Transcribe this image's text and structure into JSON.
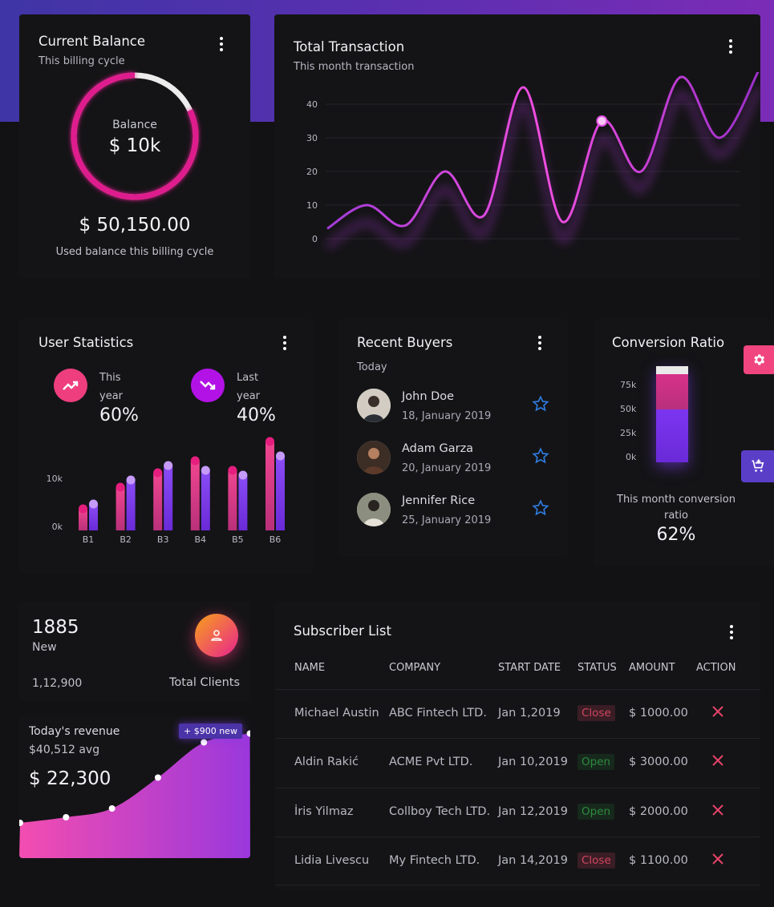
{
  "colors": {
    "accent_pink": "#e91e8c",
    "accent_purple": "#7c3aed",
    "danger": "#d0465f",
    "success": "#2f8a3f",
    "star": "#2f7de1"
  },
  "balance": {
    "title": "Current Balance",
    "subtitle": "This billing cycle",
    "ring_label": "Balance",
    "ring_value": "$ 10k",
    "amount": "$ 50,150.00",
    "caption": "Used balance this billing cycle",
    "ring_progress": 0.82
  },
  "transaction": {
    "title": "Total Transaction",
    "subtitle": "This month transaction"
  },
  "chart_data": {
    "type": "line",
    "title": "Total Transaction",
    "y_ticks": [
      "0",
      "10",
      "20",
      "30",
      "40"
    ],
    "ylim": [
      0,
      45
    ],
    "x": [
      1,
      2,
      3,
      4,
      5,
      6,
      7,
      8,
      9,
      10,
      11
    ],
    "values": [
      3,
      10,
      4,
      20,
      7,
      45,
      5,
      35,
      20,
      48,
      30,
      50
    ],
    "highlight_index": 7,
    "grid": true
  },
  "user_stats": {
    "title": "User Statistics",
    "this_year": {
      "label1": "This",
      "label2": "year",
      "value": "60%",
      "icon": "trending-up-icon"
    },
    "last_year": {
      "label1": "Last",
      "label2": "year",
      "value": "40%",
      "icon": "trending-down-icon"
    },
    "chart": {
      "type": "bar",
      "y_ticks": [
        "10k",
        "0k"
      ],
      "categories": [
        "B1",
        "B2",
        "B3",
        "B4",
        "B5",
        "B6"
      ],
      "series": [
        {
          "values": [
            4.5,
            9,
            12,
            14.5,
            12.5,
            18.5
          ]
        },
        {
          "values": [
            5.5,
            10.5,
            13.5,
            12.5,
            11.5,
            15.5
          ]
        }
      ],
      "max": 20
    }
  },
  "buyers": {
    "title": "Recent Buyers",
    "subtitle": "Today",
    "items": [
      {
        "name": "John Doe",
        "date": "18, January 2019"
      },
      {
        "name": "Adam Garza",
        "date": "20, January 2019"
      },
      {
        "name": "Jennifer Rice",
        "date": "25, January 2019"
      }
    ]
  },
  "conversion": {
    "title": "Conversion Ratio",
    "y_ticks": [
      "75k",
      "50k",
      "25k",
      "0k"
    ],
    "caption_line1": "This month conversion",
    "caption_line2": "ratio",
    "value": "62%",
    "segments": {
      "purple": 0.55,
      "pink": 0.37,
      "light": 0.08
    }
  },
  "clients": {
    "count": "1885",
    "count_label": "New",
    "total": "1,12,900",
    "total_label": "Total Clients",
    "icon": "user-icon"
  },
  "revenue": {
    "title": "Today's revenue",
    "avg": "$40,512 avg",
    "value": "$ 22,300",
    "badge": "+ $900 new",
    "points": [
      0.7,
      0.1,
      0.2,
      0.55,
      0.95,
      1.05
    ]
  },
  "subscribers": {
    "title": "Subscriber List",
    "headers": [
      "NAME",
      "COMPANY",
      "START DATE",
      "STATUS",
      "AMOUNT",
      "ACTION"
    ],
    "rows": [
      {
        "name": "Michael Austin",
        "company": "ABC Fintech LTD.",
        "date": "Jan 1,2019",
        "status": "Close",
        "amount": "$ 1000.00"
      },
      {
        "name": "Aldin Rakić",
        "company": "ACME Pvt LTD.",
        "date": "Jan 10,2019",
        "status": "Open",
        "amount": "$ 3000.00"
      },
      {
        "name": "İris Yilmaz",
        "company": "Collboy Tech LTD.",
        "date": "Jan 12,2019",
        "status": "Open",
        "amount": "$ 2000.00"
      },
      {
        "name": "Lidia Livescu",
        "company": "My Fintech LTD.",
        "date": "Jan 14,2019",
        "status": "Close",
        "amount": "$ 1100.00"
      }
    ]
  }
}
